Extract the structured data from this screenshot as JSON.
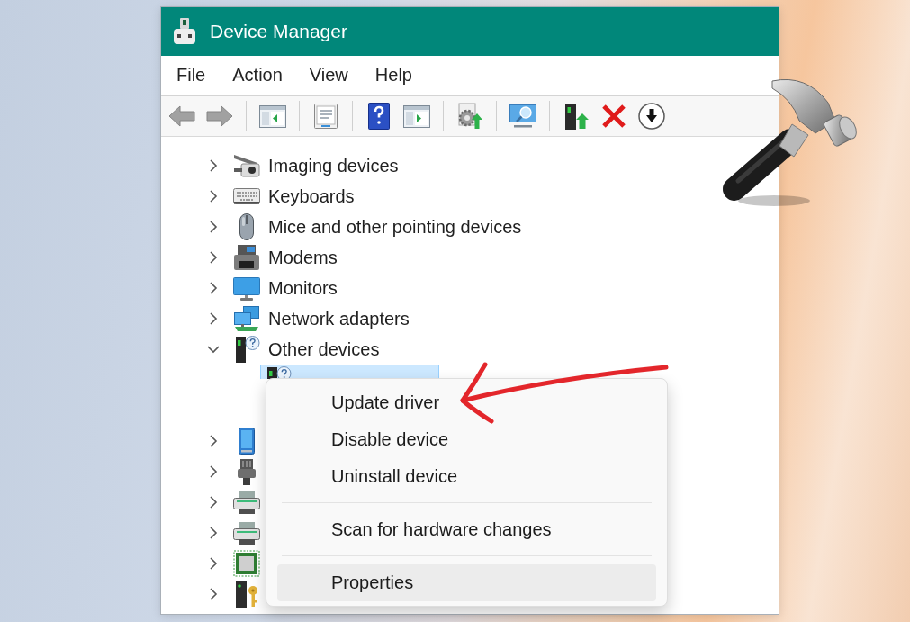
{
  "window": {
    "title": "Device Manager"
  },
  "menu_bar": [
    {
      "label": "File"
    },
    {
      "label": "Action"
    },
    {
      "label": "View"
    },
    {
      "label": "Help"
    }
  ],
  "toolbar": [
    {
      "buttons": [
        {
          "disabled": true
        },
        {
          "disabled": true
        }
      ]
    },
    {
      "buttons": [
        {
          "disabled": false
        }
      ]
    },
    {
      "buttons": [
        {
          "disabled": false
        }
      ]
    },
    {
      "buttons": [
        {
          "disabled": false
        },
        {
          "disabled": false
        }
      ]
    },
    {
      "buttons": [
        {
          "disabled": false
        }
      ]
    },
    {
      "buttons": [
        {
          "disabled": false
        }
      ]
    },
    {
      "buttons": [
        {
          "disabled": false
        },
        {
          "disabled": false
        },
        {
          "disabled": false
        }
      ]
    }
  ],
  "tree": [
    {
      "label": "Imaging devices",
      "expanded": false
    },
    {
      "label": "Keyboards",
      "expanded": false
    },
    {
      "label": "Mice and other pointing devices",
      "expanded": false
    },
    {
      "label": "Modems",
      "expanded": false
    },
    {
      "label": "Monitors",
      "expanded": false
    },
    {
      "label": "Network adapters",
      "expanded": false
    },
    {
      "label": "Other devices",
      "expanded": true,
      "children": [
        {
          "selected": true
        }
      ]
    },
    {
      "expanded": false
    },
    {
      "expanded": false
    },
    {
      "expanded": false
    },
    {
      "expanded": false
    },
    {
      "expanded": false
    },
    {
      "expanded": false
    }
  ],
  "context_menu": {
    "items": [
      {
        "kind": "item",
        "label": "Update driver",
        "selected": false
      },
      {
        "kind": "item",
        "label": "Disable device",
        "selected": false
      },
      {
        "kind": "item",
        "label": "Uninstall device",
        "selected": false
      },
      {
        "kind": "separator"
      },
      {
        "kind": "item",
        "label": "Scan for hardware changes",
        "selected": false
      },
      {
        "kind": "separator"
      },
      {
        "kind": "item",
        "label": "Properties",
        "selected": true
      }
    ]
  }
}
